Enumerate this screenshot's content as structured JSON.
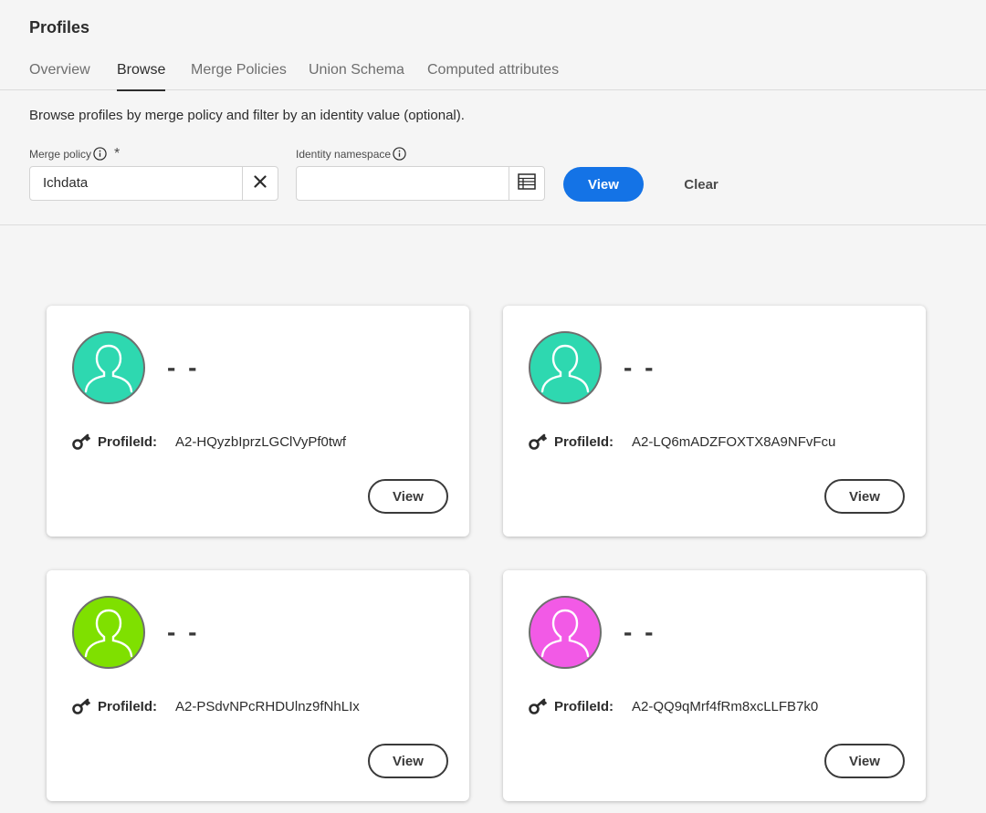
{
  "header": {
    "title": "Profiles",
    "tabs": [
      {
        "label": "Overview"
      },
      {
        "label": "Browse"
      },
      {
        "label": "Merge Policies"
      },
      {
        "label": "Union Schema"
      },
      {
        "label": "Computed attributes"
      }
    ],
    "active_tab": "Browse"
  },
  "description": "Browse profiles by merge policy and filter by an identity value (optional).",
  "filters": {
    "merge_policy": {
      "label": "Merge policy",
      "required_mark": "*",
      "value": "Ichdata",
      "clear_icon": "close-icon"
    },
    "identity_namespace": {
      "label": "Identity namespace",
      "value": "",
      "picker_icon": "table-icon"
    },
    "view_label": "View",
    "clear_label": "Clear",
    "accent_color": "#1473e6"
  },
  "profiles": [
    {
      "name": "- -",
      "id_label": "ProfileId:",
      "id": "A2-HQyzbIprzLGClVyPf0twf",
      "avatar_color": "#2ed8b0",
      "view_label": "View"
    },
    {
      "name": "- -",
      "id_label": "ProfileId:",
      "id": "A2-LQ6mADZFOXTX8A9NFvFcu",
      "avatar_color": "#2ed8b0",
      "view_label": "View"
    },
    {
      "name": "- -",
      "id_label": "ProfileId:",
      "id": "A2-PSdvNPcRHDUlnz9fNhLIx",
      "avatar_color": "#7fe000",
      "view_label": "View"
    },
    {
      "name": "- -",
      "id_label": "ProfileId:",
      "id": "A2-QQ9qMrf4fRm8xcLLFB7k0",
      "avatar_color": "#f25ae6",
      "view_label": "View"
    }
  ]
}
